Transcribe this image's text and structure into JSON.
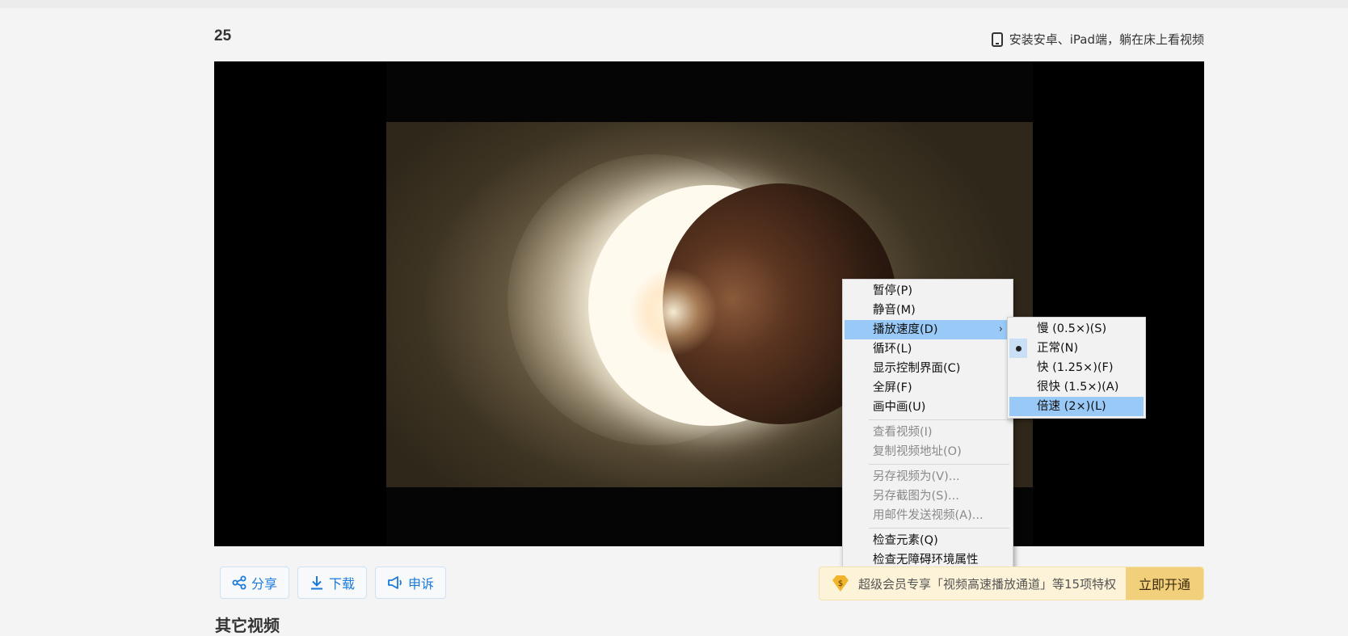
{
  "header": {
    "title": "25",
    "app_promo": "安装安卓、iPad端，躺在床上看视频"
  },
  "context_menu": {
    "items": [
      {
        "label": "暂停(P)",
        "state": "enabled"
      },
      {
        "label": "静音(M)",
        "state": "enabled"
      },
      {
        "label": "播放速度(D)",
        "state": "highlighted",
        "submenu": true
      },
      {
        "label": "循环(L)",
        "state": "enabled"
      },
      {
        "label": "显示控制界面(C)",
        "state": "enabled"
      },
      {
        "label": "全屏(F)",
        "state": "enabled"
      },
      {
        "label": "画中画(U)",
        "state": "enabled"
      },
      {
        "label": "查看视频(I)",
        "state": "disabled"
      },
      {
        "label": "复制视频地址(O)",
        "state": "disabled"
      },
      {
        "label": "另存视频为(V)...",
        "state": "disabled"
      },
      {
        "label": "另存截图为(S)...",
        "state": "disabled"
      },
      {
        "label": "用邮件发送视频(A)...",
        "state": "disabled"
      },
      {
        "label": "检查元素(Q)",
        "state": "enabled"
      },
      {
        "label": "检查无障碍环境属性",
        "state": "enabled"
      }
    ],
    "submenu_arrow": "›"
  },
  "speed_submenu": {
    "items": [
      {
        "label": "慢 (0.5×)(S)"
      },
      {
        "label": "正常(N)",
        "checked": true
      },
      {
        "label": "快 (1.25×)(F)"
      },
      {
        "label": "很快 (1.5×)(A)"
      },
      {
        "label": "倍速 (2×)(L)",
        "highlighted": true
      }
    ]
  },
  "actions": {
    "share": "分享",
    "download": "下载",
    "report": "申诉"
  },
  "vip_banner": {
    "text": "超级会员专享「视频高速播放通道」等15项特权",
    "button": "立即开通"
  },
  "section": {
    "more_videos": "其它视频"
  },
  "colors": {
    "accent_blue": "#1a7ad9",
    "menu_highlight": "#99c9f6",
    "vip_button": "#f2cf7a"
  }
}
